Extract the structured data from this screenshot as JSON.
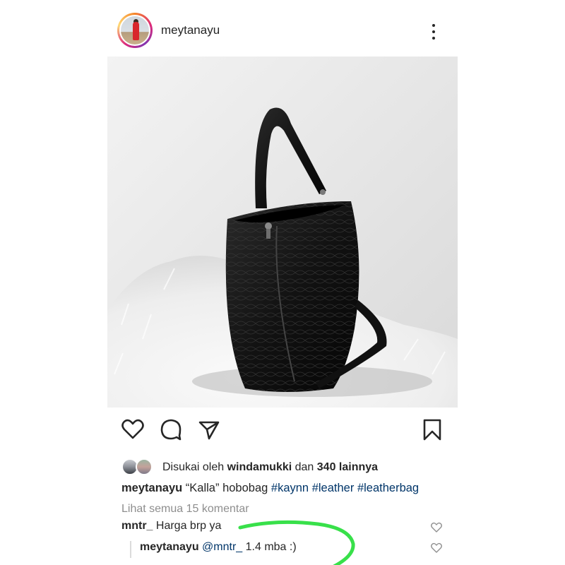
{
  "post": {
    "author": "meytanayu",
    "icons": {
      "more": "more-vertical-icon",
      "like": "heart-icon",
      "comment": "comment-icon",
      "share": "send-icon",
      "save": "bookmark-icon"
    }
  },
  "likes": {
    "prefix": "Disukai oleh ",
    "user": "windamukki",
    "middle": " dan ",
    "count": "340 lainnya"
  },
  "caption": {
    "user": "meytanayu",
    "text": " “Kalla” hobobag ",
    "hashtags": [
      "#kaynn",
      "#leather",
      "#leatherbag"
    ]
  },
  "view_all_comments": "Lihat semua 15 komentar",
  "comments": [
    {
      "user": "mntr_",
      "text": " Harga brp ya"
    },
    {
      "user": "meytanayu",
      "mention": " @mntr_",
      "text": " 1.4 mba :)"
    }
  ],
  "colors": {
    "text": "#262626",
    "muted": "#8e8e8e",
    "link": "#003569",
    "annotation_green": "#38e04a"
  }
}
